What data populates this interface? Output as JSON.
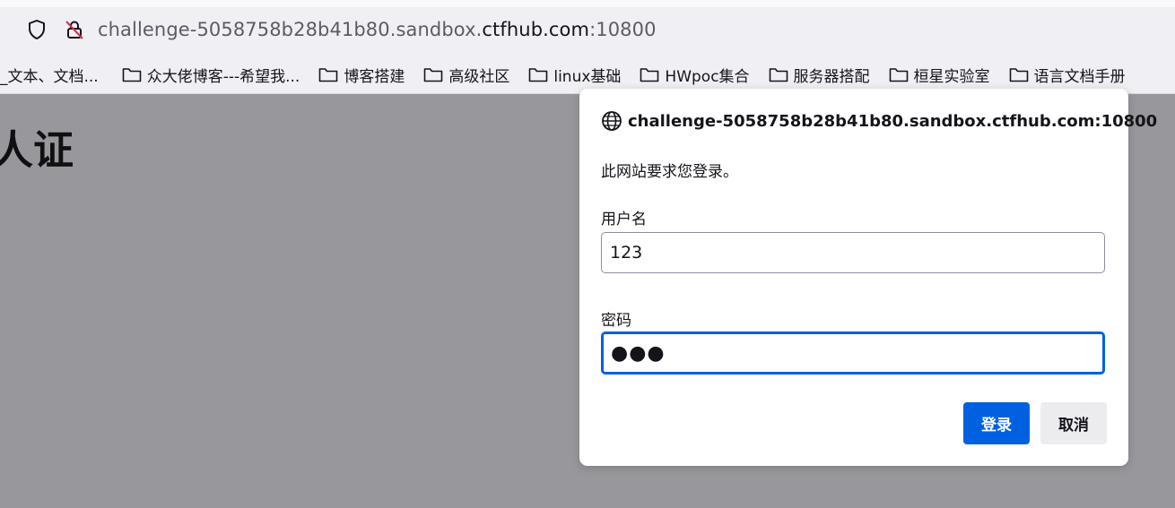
{
  "browser": {
    "url_prefix": "challenge-5058758b28b41b80.sandbox.",
    "url_domain": "ctfhub.com",
    "url_suffix": ":10800",
    "shield_icon": "shield-icon",
    "lock_icon": "insecure-lock-icon"
  },
  "bookmarks": [
    {
      "label": "_文本、文档...",
      "icon": ""
    },
    {
      "label": "众大佬博客---希望我...",
      "icon": "folder-icon"
    },
    {
      "label": "博客搭建",
      "icon": "folder-icon"
    },
    {
      "label": "高级社区",
      "icon": "folder-icon"
    },
    {
      "label": "linux基础",
      "icon": "folder-icon"
    },
    {
      "label": "HWpoc集合",
      "icon": "folder-icon"
    },
    {
      "label": "服务器搭配",
      "icon": "folder-icon"
    },
    {
      "label": "桓星实验室",
      "icon": "folder-icon"
    },
    {
      "label": "语言文档手册",
      "icon": "folder-icon"
    }
  ],
  "page": {
    "heading": "人证"
  },
  "dialog": {
    "origin": "challenge-5058758b28b41b80.sandbox.ctfhub.com:10800",
    "message": "此网站要求您登录。",
    "username_label": "用户名",
    "username_value": "123",
    "password_label": "密码",
    "password_masked": "●●●",
    "login_label": "登录",
    "cancel_label": "取消"
  },
  "colors": {
    "accent": "#0061e0",
    "overlay": "#98989c"
  }
}
